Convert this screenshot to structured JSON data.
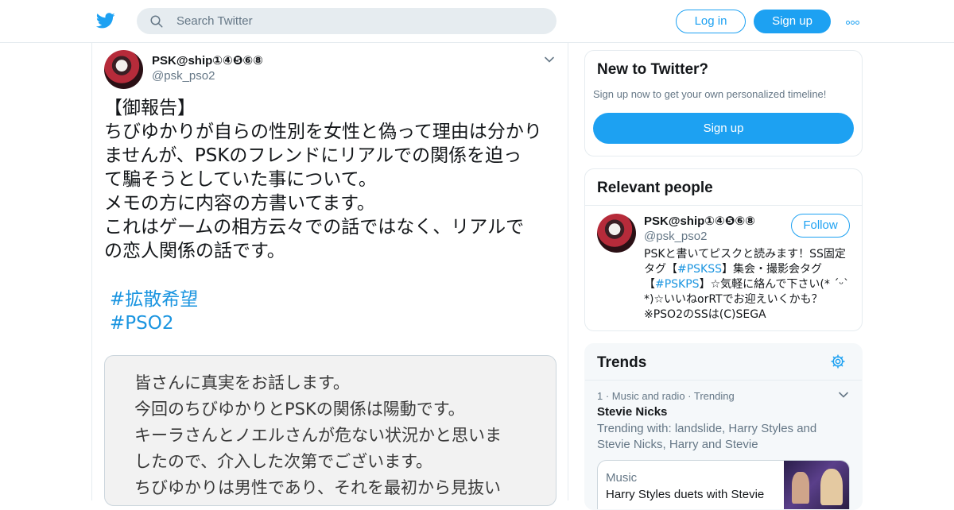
{
  "colors": {
    "accent": "#1da1f2",
    "link": "#1b95e0",
    "secondary_text": "#657786"
  },
  "header": {
    "logo_icon": "twitter-bird-icon",
    "search_placeholder": "Search Twitter",
    "login_label": "Log in",
    "signup_label": "Sign up",
    "more_icon": "more-dots-icon"
  },
  "tweet": {
    "author_name": "PSK@ship①④❺⑥⑧",
    "author_handle": "@psk_pso2",
    "text": "【御報告】\nちびゆかりが自らの性別を女性と偽って理由は分かり\nませんが、PSKのフレンドにリアルでの関係を迫っ\nて騙そうとしていた事について。\nメモの方に内容の方書いてます。\nこれはゲームの相方云々での話ではなく、リアルで\nの恋人関係の話です。",
    "hashtags": [
      "#拡散希望",
      "#PSO2"
    ],
    "memo_text": "皆さんに真実をお話します。\n今回のちびゆかりとPSKの関係は陽動です。\nキーラさんとノエルさんが危ない状況かと思いま\nしたので、介入した次第でございます。\nちびゆかりは男性であり、それを最初から見抜い"
  },
  "sidebar": {
    "new_to_twitter": {
      "title": "New to Twitter?",
      "subtitle": "Sign up now to get your own personalized timeline!",
      "signup_label": "Sign up"
    },
    "relevant_people": {
      "title": "Relevant people",
      "name": "PSK@ship①④❺⑥⑧",
      "handle": "@psk_pso2",
      "follow_label": "Follow",
      "bio_part1": "PSKと書いてピスクと読みます！SS固定タグ【",
      "bio_tag1": "#PSKSS",
      "bio_part2": "】集会・撮影会タグ【",
      "bio_tag2": "#PSKPS",
      "bio_part3": "】☆気軽に絡んで下さい(* ˊᵕˋ *)☆いいねorRTでお迎えいくかも？※PSO2のSSは(C)SEGA"
    },
    "trends": {
      "title": "Trends",
      "settings_icon": "gear-icon",
      "item1_meta": "1 · Music and radio · Trending",
      "item1_title": "Stevie Nicks",
      "item1_with": "Trending with: landslide, Harry Styles and Stevie Nicks, Harry and Stevie",
      "item1_card_category": "Music",
      "item1_card_headline": "Harry Styles duets with Stevie"
    }
  }
}
